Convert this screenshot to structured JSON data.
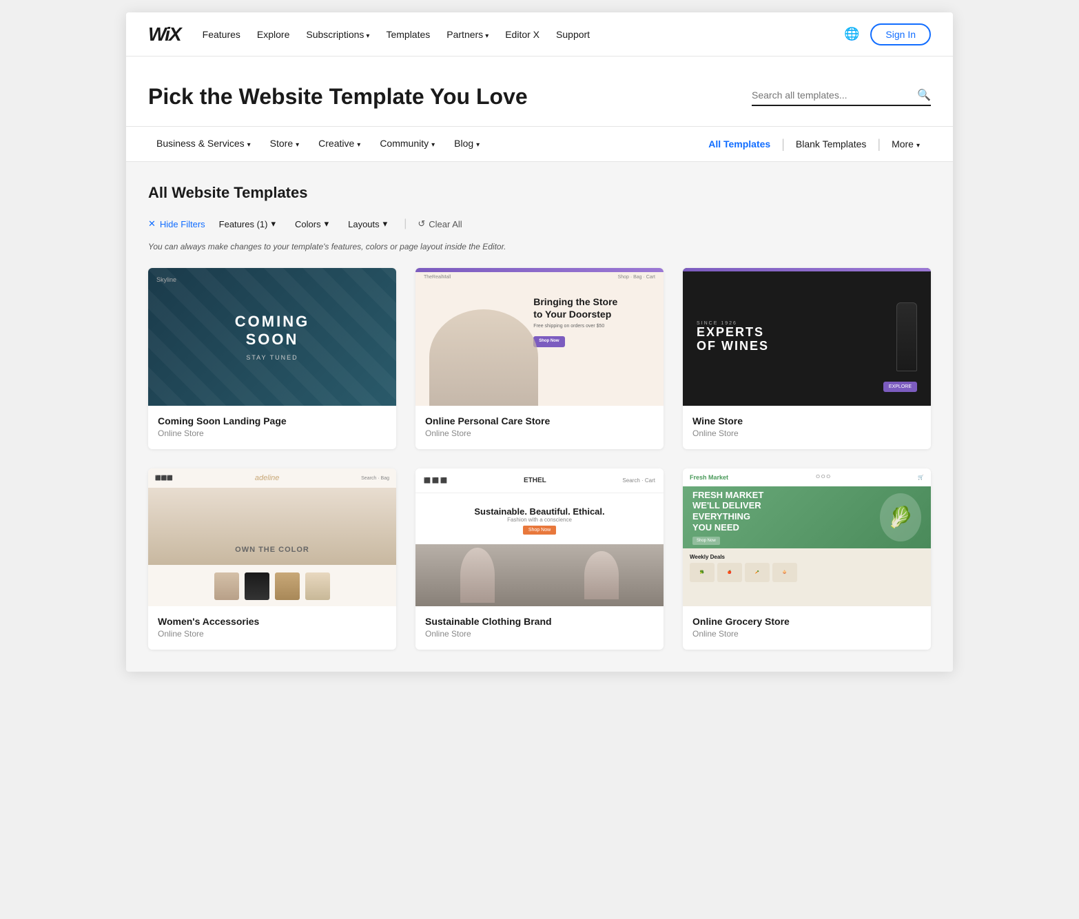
{
  "brand": {
    "logo": "WiX",
    "logo_italic": "Wi"
  },
  "navbar": {
    "links": [
      {
        "label": "Features",
        "has_dropdown": false
      },
      {
        "label": "Explore",
        "has_dropdown": false
      },
      {
        "label": "Subscriptions",
        "has_dropdown": true
      },
      {
        "label": "Templates",
        "has_dropdown": false
      },
      {
        "label": "Partners",
        "has_dropdown": true
      },
      {
        "label": "Editor X",
        "has_dropdown": false
      },
      {
        "label": "Support",
        "has_dropdown": false
      }
    ],
    "sign_in": "Sign In"
  },
  "hero": {
    "title": "Pick the Website Template You Love",
    "search_placeholder": "Search all templates..."
  },
  "category_nav": {
    "left_items": [
      {
        "label": "Business & Services",
        "has_dropdown": true
      },
      {
        "label": "Store",
        "has_dropdown": true
      },
      {
        "label": "Creative",
        "has_dropdown": true
      },
      {
        "label": "Community",
        "has_dropdown": true
      },
      {
        "label": "Blog",
        "has_dropdown": true
      }
    ],
    "right_items": [
      {
        "label": "All Templates",
        "active": true
      },
      {
        "label": "Blank Templates",
        "active": false
      },
      {
        "label": "More",
        "has_dropdown": true,
        "active": false
      }
    ]
  },
  "main": {
    "section_title": "All Website Templates",
    "filters": {
      "hide_filters_label": "Hide Filters",
      "features_label": "Features (1)",
      "colors_label": "Colors",
      "layouts_label": "Layouts",
      "clear_all_label": "Clear All"
    },
    "filter_note": "You can always make changes to your template's features, colors or page layout inside the Editor.",
    "templates": [
      {
        "id": "coming-soon",
        "name": "Coming Soon Landing Page",
        "category": "Online Store",
        "preview_type": "coming-soon"
      },
      {
        "id": "personal-care",
        "name": "Online Personal Care Store",
        "category": "Online Store",
        "preview_type": "personal-care"
      },
      {
        "id": "wine-store",
        "name": "Wine Store",
        "category": "Online Store",
        "preview_type": "wine"
      },
      {
        "id": "womens-accessories",
        "name": "Women's Accessories",
        "category": "Online Store",
        "preview_type": "accessories"
      },
      {
        "id": "sustainable-clothing",
        "name": "Sustainable Clothing Brand",
        "category": "Online Store",
        "preview_type": "sustainable"
      },
      {
        "id": "grocery-store",
        "name": "Online Grocery Store",
        "category": "Online Store",
        "preview_type": "grocery"
      }
    ]
  }
}
